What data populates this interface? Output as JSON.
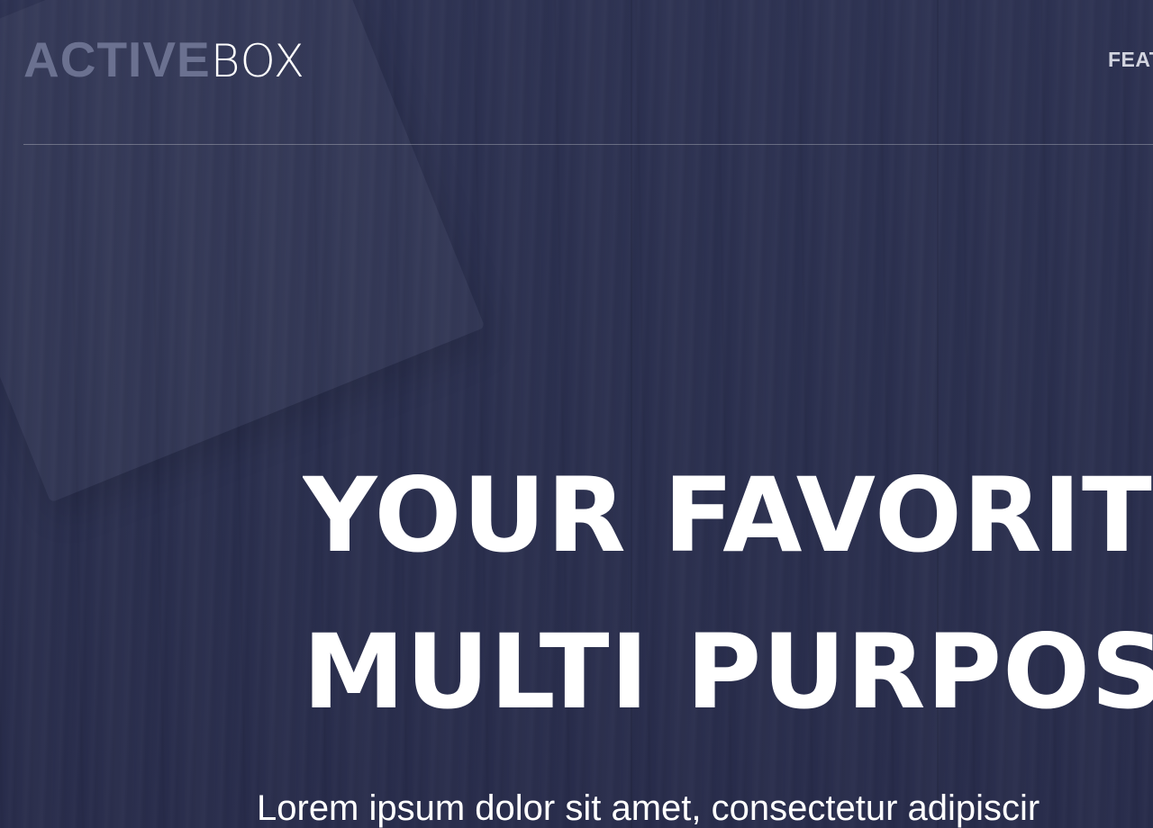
{
  "header": {
    "logo": {
      "bold": "ACTIVE",
      "light": "BOX"
    },
    "nav": {
      "item_visible": "FEAT"
    }
  },
  "hero": {
    "headline_line1": "YOUR FAVORIT",
    "headline_line2": "MULTI PURPOS",
    "subtext": "Lorem ipsum dolor sit amet, consectetur adipiscir"
  },
  "colors": {
    "background": "#2b2f4f",
    "logo_bold": "#6b7190",
    "text": "#ffffff",
    "nav_text": "#d3d5e0"
  }
}
